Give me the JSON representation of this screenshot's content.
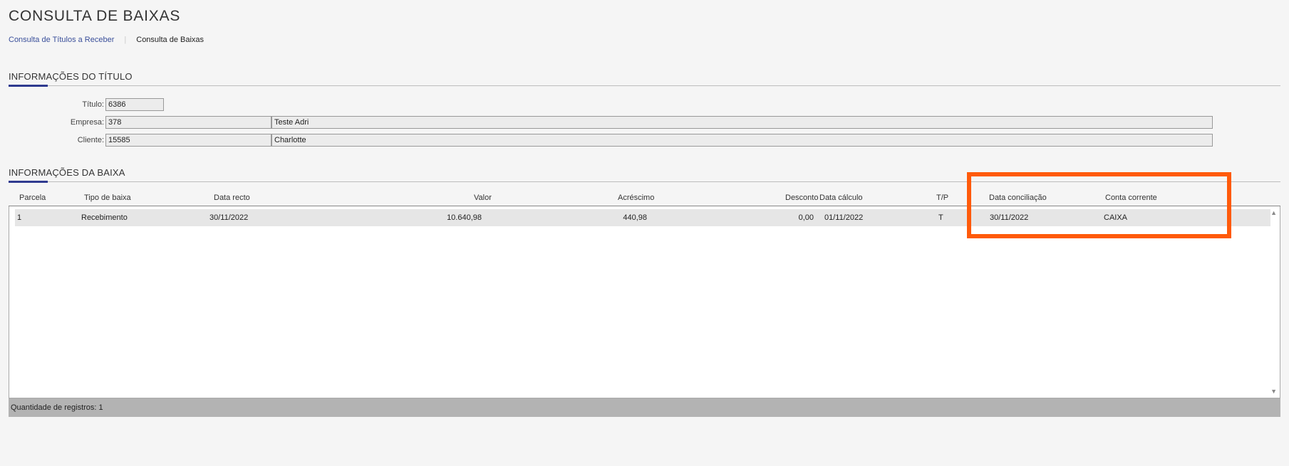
{
  "page": {
    "title": "CONSULTA DE BAIXAS"
  },
  "breadcrumb": {
    "parent": "Consulta de Títulos a Receber",
    "current": "Consulta de Baixas"
  },
  "titulo_section": {
    "heading": "INFORMAÇÕES DO TÍTULO",
    "titulo_label": "Título:",
    "titulo_value": "6386",
    "empresa_label": "Empresa:",
    "empresa_code": "378",
    "empresa_name": "Teste Adri",
    "cliente_label": "Cliente:",
    "cliente_code": "15585",
    "cliente_name": "Charlotte"
  },
  "baixa_section": {
    "heading": "INFORMAÇÕES DA BAIXA",
    "columns": [
      "Parcela",
      "Tipo de baixa",
      "Data recto",
      "Valor",
      "Acréscimo",
      "Desconto",
      "Data cálculo",
      "T/P",
      "Data conciliação",
      "Conta corrente"
    ],
    "rows": [
      [
        "1",
        "Recebimento",
        "30/11/2022",
        "10.640,98",
        "440,98",
        "0,00",
        "01/11/2022",
        "T",
        "30/11/2022",
        "CAIXA"
      ]
    ],
    "footer": "Quantidade de registros: 1"
  },
  "colors": {
    "accent": "#2f3a8f",
    "highlight": "#ff5a0a",
    "link": "#3a4f9a"
  },
  "icons": {
    "scroll_up": "chevron-up-icon",
    "scroll_down": "chevron-down-icon"
  }
}
